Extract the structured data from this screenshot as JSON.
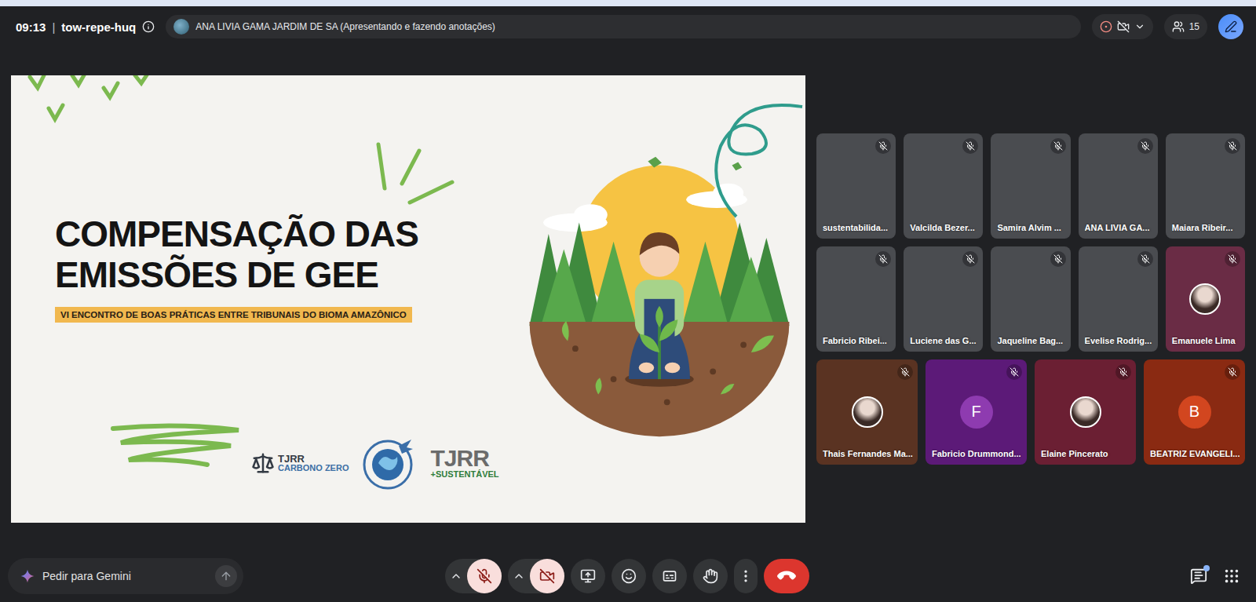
{
  "meeting": {
    "time": "09:13",
    "separator": "|",
    "code": "tow-repe-huq"
  },
  "presenter": {
    "label": "ANA LIVIA GAMA JARDIM DE SA (Apresentando e fazendo anotações)"
  },
  "participants_count": "15",
  "slide": {
    "title": "COMPENSAÇÃO DAS EMISSÕES DE GEE",
    "subtitle": "VI ENCONTRO DE BOAS PRÁTICAS ENTRE TRIBUNAIS DO BIOMA AMAZÔNICO",
    "logos": [
      {
        "kind": "carbon",
        "title": "TJRR",
        "caption": "CARBONO ZERO"
      },
      {
        "kind": "seal"
      },
      {
        "kind": "sustainable",
        "title": "TJRR",
        "caption": "+SUSTENTÁVEL"
      }
    ]
  },
  "participants": [
    {
      "name": "sustentabilida...",
      "kind": "video",
      "muted": true
    },
    {
      "name": "Valcilda Bezer...",
      "kind": "video",
      "muted": true
    },
    {
      "name": "Samira Alvim ...",
      "kind": "video",
      "muted": true
    },
    {
      "name": "ANA LIVIA GA...",
      "kind": "video",
      "muted": true
    },
    {
      "name": "Maiara Ribeir...",
      "kind": "video",
      "muted": true
    },
    {
      "name": "Fabricio Ribei...",
      "kind": "video",
      "muted": true
    },
    {
      "name": "Luciene das G...",
      "kind": "video",
      "muted": true
    },
    {
      "name": "Jaqueline Bag...",
      "kind": "video",
      "muted": true
    },
    {
      "name": "Evelise Rodrig...",
      "kind": "video",
      "muted": true
    },
    {
      "name": "Emanuele Lima",
      "kind": "photo",
      "muted": true,
      "color": "#6a2c45"
    },
    {
      "name": "Thais Fernandes Ma...",
      "kind": "photo",
      "muted": true,
      "color": "#5a3322"
    },
    {
      "name": "Fabricio Drummond...",
      "kind": "letter",
      "initial": "F",
      "muted": true,
      "color": "#5c1a78",
      "avatar": "#8e3bb0"
    },
    {
      "name": "Elaine Pincerato",
      "kind": "photo",
      "muted": true,
      "color": "#6b1f33"
    },
    {
      "name": "BEATRIZ EVANGELI...",
      "kind": "letter",
      "initial": "B",
      "muted": true,
      "color": "#8a2a12",
      "avatar": "#d2461f"
    }
  ],
  "gemini": {
    "placeholder": "Pedir para Gemini"
  },
  "controls": [
    {
      "kind": "mic",
      "on": false
    },
    {
      "kind": "camera",
      "on": false
    },
    {
      "kind": "present"
    },
    {
      "kind": "emoji"
    },
    {
      "kind": "captions"
    },
    {
      "kind": "hand"
    },
    {
      "kind": "more"
    },
    {
      "kind": "leave"
    }
  ],
  "chat": {
    "unread": true
  }
}
